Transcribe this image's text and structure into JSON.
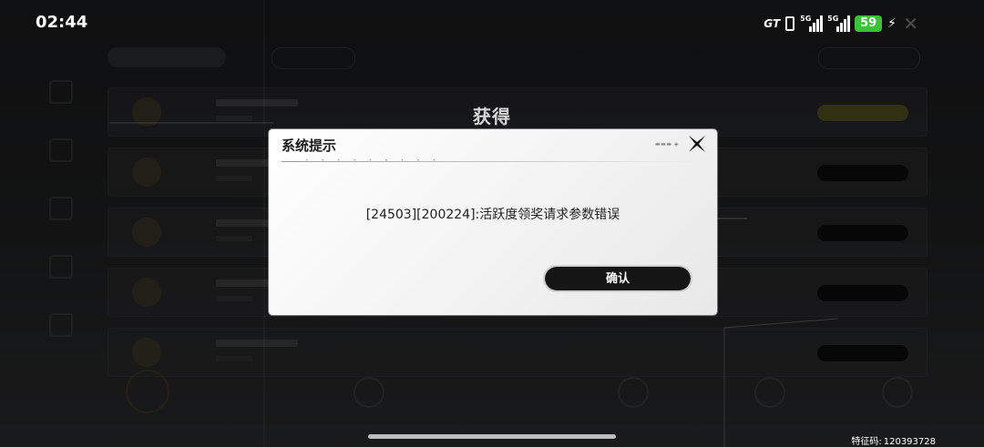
{
  "status_bar": {
    "time": "02:44",
    "carrier_badge": "GT",
    "sim1_label": "5G",
    "sim2_label": "5G",
    "battery_level": "59"
  },
  "background": {
    "title": "获得",
    "rows_count_visible": 5
  },
  "dialog": {
    "title": "系统提示",
    "message": "[24503][200224]:活跃度领奖请求参数错误",
    "confirm_label": "确认"
  },
  "footer": {
    "feature_code_label": "特征码:",
    "feature_code_value": "120393728"
  },
  "colors": {
    "battery": "#3cc13b",
    "dialog_bg": "#f5f5f5",
    "button_bg": "#151515"
  }
}
